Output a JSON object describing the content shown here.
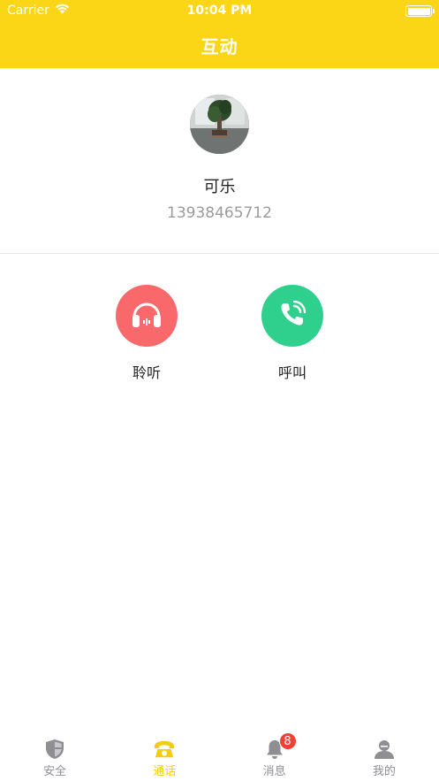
{
  "status_bar": {
    "carrier": "Carrier",
    "time": "10:04 PM"
  },
  "header": {
    "title": "互动"
  },
  "profile": {
    "name": "可乐",
    "phone": "13938465712"
  },
  "actions": [
    {
      "label": "聆听",
      "icon": "headphones-icon",
      "color": "#f9686b"
    },
    {
      "label": "呼叫",
      "icon": "phone-call-icon",
      "color": "#2fd08d"
    }
  ],
  "tabbar": {
    "tabs": [
      {
        "label": "安全",
        "icon": "shield-icon",
        "active": false
      },
      {
        "label": "通话",
        "icon": "telephone-icon",
        "active": true
      },
      {
        "label": "消息",
        "icon": "bell-icon",
        "active": false,
        "badge": "8"
      },
      {
        "label": "我的",
        "icon": "user-icon",
        "active": false
      }
    ]
  },
  "colors": {
    "accent": "#fad617",
    "active_tab": "#f5cc11",
    "badge": "#f04135"
  }
}
